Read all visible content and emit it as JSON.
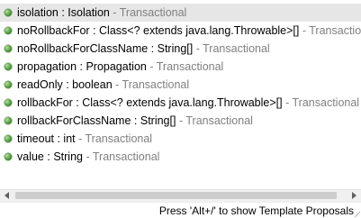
{
  "proposals": [
    {
      "name": "isolation",
      "type": "Isolation",
      "owner": "Transactional",
      "selected": true
    },
    {
      "name": "noRollbackFor",
      "type": "Class<? extends java.lang.Throwable>[]",
      "owner": "Transactional",
      "selected": false
    },
    {
      "name": "noRollbackForClassName",
      "type": "String[]",
      "owner": "Transactional",
      "selected": false
    },
    {
      "name": "propagation",
      "type": "Propagation",
      "owner": "Transactional",
      "selected": false
    },
    {
      "name": "readOnly",
      "type": "boolean",
      "owner": "Transactional",
      "selected": false
    },
    {
      "name": "rollbackFor",
      "type": "Class<? extends java.lang.Throwable>[]",
      "owner": "Transactional",
      "selected": false
    },
    {
      "name": "rollbackForClassName",
      "type": "String[]",
      "owner": "Transactional",
      "selected": false
    },
    {
      "name": "timeout",
      "type": "int",
      "owner": "Transactional",
      "selected": false
    },
    {
      "name": "value",
      "type": "String",
      "owner": "Transactional",
      "selected": false
    }
  ],
  "icons": {
    "proposal": "public-method-green-dot-icon",
    "scroll_left": "arrow-left-icon",
    "scroll_right": "arrow-right-icon"
  },
  "colors": {
    "selection": "#e6e6e6",
    "owner_text": "#808080",
    "icon": "#4f9a3c"
  },
  "status": {
    "hint": "Press 'Alt+/' to show Template Proposals"
  }
}
